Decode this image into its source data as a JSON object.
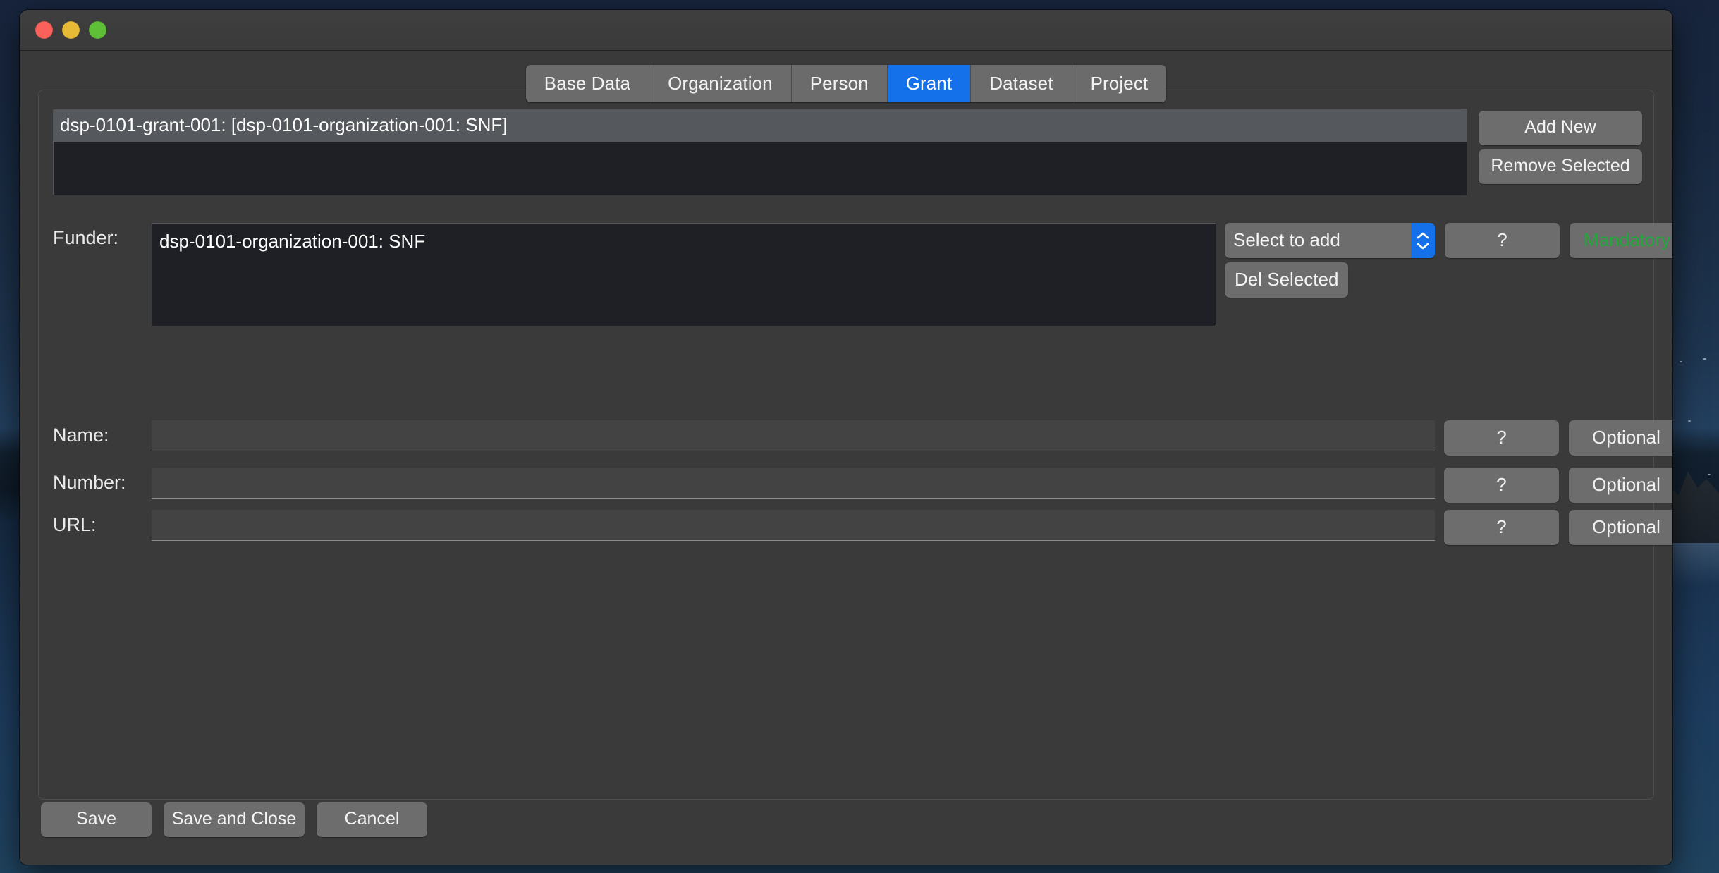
{
  "window": {
    "traffic_lights": [
      "close",
      "minimize",
      "maximize"
    ]
  },
  "tabs": [
    {
      "label": "Base Data",
      "active": false
    },
    {
      "label": "Organization",
      "active": false
    },
    {
      "label": "Person",
      "active": false
    },
    {
      "label": "Grant",
      "active": true
    },
    {
      "label": "Dataset",
      "active": false
    },
    {
      "label": "Project",
      "active": false
    }
  ],
  "entry_list": {
    "items": [
      {
        "label": "dsp-0101-grant-001: [dsp-0101-organization-001: SNF]",
        "selected": true
      }
    ]
  },
  "top_buttons": {
    "add_new": "Add New",
    "remove_selected": "Remove Selected"
  },
  "fields": {
    "funder": {
      "label": "Funder:",
      "values": [
        "dsp-0101-organization-001: SNF"
      ],
      "select_label": "Select to add",
      "del_label": "Del Selected",
      "help": "?",
      "status": "Mandatory"
    },
    "name": {
      "label": "Name:",
      "value": "",
      "placeholder": "",
      "help": "?",
      "status": "Optional"
    },
    "number": {
      "label": "Number:",
      "value": "",
      "placeholder": "",
      "help": "?",
      "status": "Optional"
    },
    "url": {
      "label": "URL:",
      "value": "",
      "placeholder": "",
      "help": "?",
      "status": "Optional"
    }
  },
  "bottom_buttons": {
    "save": "Save",
    "save_and_close": "Save and Close",
    "cancel": "Cancel"
  },
  "colors": {
    "accent_blue": "#1571ea",
    "mandatory_green": "#21a83b",
    "window_bg": "#3a3a3a",
    "list_bg": "#1e2025",
    "selection": "#55585c",
    "button_bg": "#6d6d6d",
    "input_bg": "#434343"
  }
}
